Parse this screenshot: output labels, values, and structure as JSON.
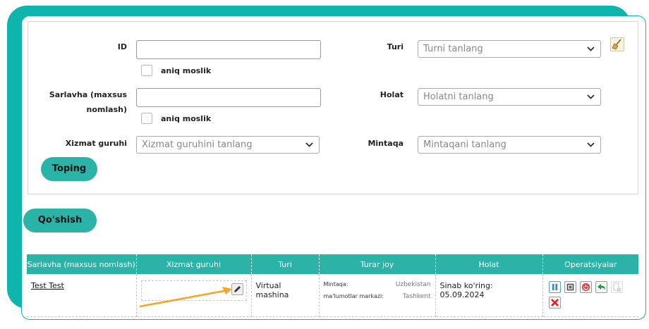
{
  "filters": {
    "id_label": "ID",
    "id_value": "",
    "exact_match_label": "aniq moslik",
    "title_label": "Sarlavha (maxsus nomlash)",
    "title_value": "",
    "service_group_label": "Xizmat guruhi",
    "service_group_placeholder": "Xizmat guruhini tanlang",
    "type_label": "Turi",
    "type_placeholder": "Turni tanlang",
    "status_label": "Holat",
    "status_placeholder": "Holatni tanlang",
    "region_label": "Mintaqa",
    "region_placeholder": "Mintaqani tanlang",
    "search_button": "Toping"
  },
  "add_button": "Qo'shish",
  "table": {
    "headers": [
      "Sarlavha (maxsus nomlash)",
      "Xizmat guruhi",
      "Turi",
      "Turar joy",
      "Holat",
      "Operatsiyalar"
    ],
    "rows": [
      {
        "title": "Test Test",
        "service_group": "",
        "type": "Virtual mashina",
        "location": {
          "region_label": "Mintaqa:",
          "region_value": "Uzbekistan",
          "dc_label": "ma'lumotlar markazi:",
          "dc_value": "Tashkent"
        },
        "status": "Sinab ko'ring: 05.09.2024"
      }
    ]
  },
  "icons": {
    "clear": "broom-icon",
    "edit": "pencil-icon",
    "pause": "pause-icon",
    "stop": "stop-icon",
    "power": "power-icon",
    "back": "undo-arrow-icon",
    "disabled": "disabled-delete-icon",
    "delete": "red-x-icon"
  },
  "colors": {
    "accent": "#2cb3a8",
    "frame": "#0fb5ad",
    "arrow": "#f5a623",
    "delete": "#e02020"
  }
}
